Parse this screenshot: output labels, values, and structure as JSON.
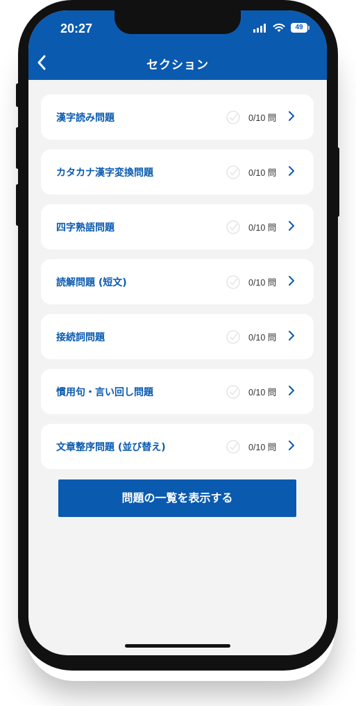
{
  "status_bar": {
    "time": "20:27",
    "battery": "49"
  },
  "header": {
    "title": "セクション"
  },
  "sections": [
    {
      "label": "漢字読み問題",
      "count": "0/10 問"
    },
    {
      "label": "カタカナ漢字変換問題",
      "count": "0/10 問"
    },
    {
      "label": "四字熟語問題",
      "count": "0/10 問"
    },
    {
      "label": "読解問題 (短文)",
      "count": "0/10 問"
    },
    {
      "label": "接続詞問題",
      "count": "0/10 問"
    },
    {
      "label": "慣用句・言い回し問題",
      "count": "0/10 問"
    },
    {
      "label": "文章整序問題 (並び替え)",
      "count": "0/10 問"
    }
  ],
  "cta": {
    "label": "問題の一覧を表示する"
  },
  "colors": {
    "accent": "#0a5ab0",
    "background": "#f3f3f3"
  }
}
